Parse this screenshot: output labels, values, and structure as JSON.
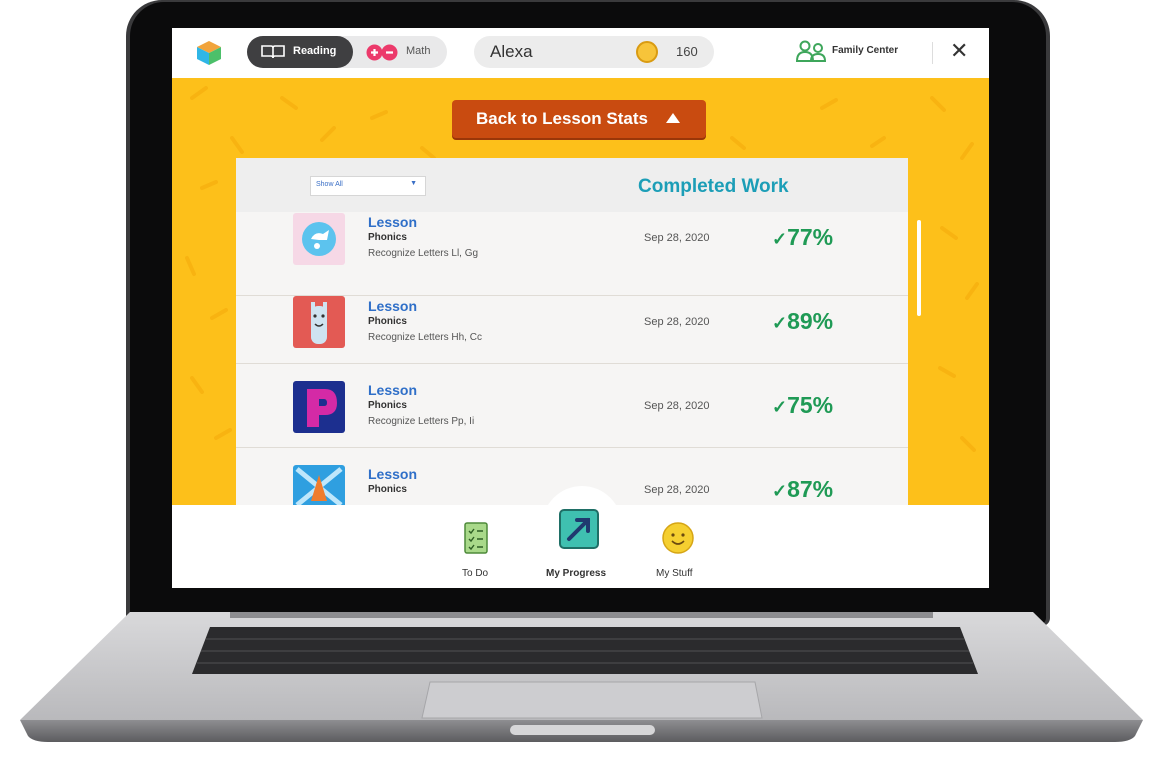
{
  "topbar": {
    "subjects": [
      {
        "label": "Reading",
        "active": true
      },
      {
        "label": "Math",
        "active": false
      }
    ],
    "student_name": "Alexa",
    "coins": "160",
    "family_center": "Family Center",
    "close_glyph": "✕"
  },
  "back_button": {
    "label": "Back to Lesson Stats"
  },
  "filter": {
    "selected": "Show All"
  },
  "panel_title": "Completed Work",
  "rows": [
    {
      "title": "Lesson",
      "category": "Phonics",
      "subtitle": "Recognize Letters Ll, Gg",
      "date": "Sep 28, 2020",
      "score": "77%",
      "icon": "letter-g-art"
    },
    {
      "title": "Lesson",
      "category": "Phonics",
      "subtitle": "Recognize Letters Hh, Cc",
      "date": "Sep 28, 2020",
      "score": "89%",
      "icon": "llama-art"
    },
    {
      "title": "Lesson",
      "category": "Phonics",
      "subtitle": "Recognize Letters Pp, Ii",
      "date": "Sep 28, 2020",
      "score": "75%",
      "icon": "letter-p-art"
    },
    {
      "title": "Lesson",
      "category": "Phonics",
      "subtitle": "",
      "date": "Sep 28, 2020",
      "score": "87%",
      "icon": "rocket-art"
    }
  ],
  "score_check": "✓",
  "bottom_nav": [
    {
      "label": "To Do",
      "icon": "checklist-icon"
    },
    {
      "label": "My Progress",
      "icon": "progress-arrow-icon",
      "active": true
    },
    {
      "label": "My Stuff",
      "icon": "smiley-icon"
    }
  ],
  "colors": {
    "accent_yellow": "#fdc01a",
    "button_orange": "#c94b10",
    "title_teal": "#1c9eb7",
    "score_green": "#1f9a55",
    "link_blue": "#2f6fc8"
  }
}
